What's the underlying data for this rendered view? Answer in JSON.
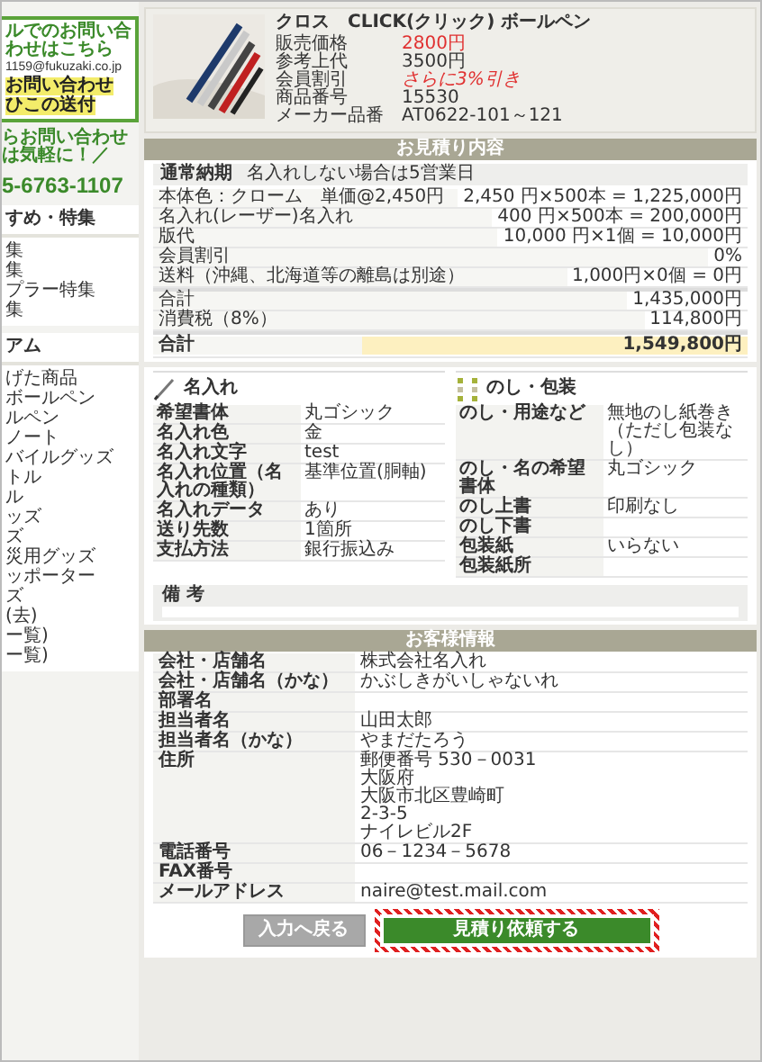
{
  "sidebar": {
    "contact": {
      "mail_label": "ルでのお問い合わせはこちら",
      "email": "1159@fukuzaki.co.jp",
      "links": [
        "お問い合わせ",
        "ひこの送付"
      ]
    },
    "phone_label": "らお問い合わせは気軽に！／",
    "phone": "5-6763-1107",
    "menus": [
      {
        "heading": "すめ・特集",
        "items": [
          "集",
          "集",
          "プラー特集",
          "集"
        ]
      },
      {
        "heading": "アム",
        "items": [
          "げた商品",
          "ボールペン",
          "ルペン",
          "ノート",
          "バイルグッズ",
          "トル",
          "ル",
          "ッズ",
          "ズ",
          "災用グッズ",
          "ッポーター",
          "ズ",
          "(去)",
          "ー覧)",
          "ー覧)"
        ]
      }
    ]
  },
  "product": {
    "title": "クロス　CLICK(クリック) ボールペン",
    "specs": [
      {
        "label": "販売価格",
        "value": "2800円",
        "kind": "price"
      },
      {
        "label": "参考上代",
        "value": "3500円",
        "kind": "plain"
      },
      {
        "label": "会員割引",
        "value": "さらに3%引き",
        "kind": "discount"
      },
      {
        "label": "商品番号",
        "value": "15530",
        "kind": "plain"
      },
      {
        "label": "メーカー品番",
        "value": "AT0622-101～121",
        "kind": "plain"
      }
    ]
  },
  "quote": {
    "title": "お見積り内容",
    "delivery_label": "通常納期",
    "delivery_value": "名入れしない場合は5営業日",
    "rows": [
      {
        "label": "本体色：クローム　単価@2,450円",
        "value": "2,450 円×500本 = 1,225,000円",
        "kind": "line"
      },
      {
        "label": "名入れ(レーザー)名入れ",
        "value": "400 円×500本 = 200,000円",
        "kind": "line"
      },
      {
        "label": "版代",
        "value": "10,000 円×1個 = 10,000円",
        "kind": "line"
      },
      {
        "label": "会員割引",
        "value": "0%",
        "kind": "line"
      },
      {
        "label": "送料（沖縄、北海道等の離島は別途）",
        "value": "1,000円×0個 = 0円",
        "kind": "line"
      },
      {
        "label": "合計",
        "value": "1,435,000円",
        "kind": "subtotal"
      },
      {
        "label": "消費税（8%）",
        "value": "114,800円",
        "kind": "line"
      },
      {
        "label": "合計",
        "value": "1,549,800円",
        "kind": "total"
      }
    ]
  },
  "details": [
    {
      "title": "名入れ",
      "kind": "pen",
      "rows": [
        {
          "label": "希望書体",
          "value": "丸ゴシック"
        },
        {
          "label": "名入れ色",
          "value": "金"
        },
        {
          "label": "名入れ文字",
          "value": "test"
        },
        {
          "label": "名入れ位置（名入れの種類）",
          "value": "基準位置(胴軸)"
        },
        {
          "label": "名入れデータ",
          "value": "あり"
        },
        {
          "label": "送り先数",
          "value": "1箇所"
        },
        {
          "label": "支払方法",
          "value": "銀行振込み"
        }
      ]
    },
    {
      "title": "のし・包装",
      "kind": "gift",
      "rows": [
        {
          "label": "のし・用途など",
          "value": "無地のし紙巻き（ただし包装なし）"
        },
        {
          "label": "のし・名の希望書体",
          "value": "丸ゴシック"
        },
        {
          "label": "のし上書",
          "value": "印刷なし"
        },
        {
          "label": "のし下書"
        },
        {
          "label": "包装紙",
          "value": "いらない"
        },
        {
          "label": "包装紙所"
        }
      ]
    }
  ],
  "remarks": {
    "label": "備 考"
  },
  "customer": {
    "title": "お客様情報",
    "rows": [
      {
        "label": "会社・店舗名",
        "value": "株式会社名入れ"
      },
      {
        "label": "会社・店舗名（かな）",
        "value": "かぶしきがいしゃないれ"
      },
      {
        "label": "部署名"
      },
      {
        "label": "担当者名",
        "value": "山田太郎"
      },
      {
        "label": "担当者名（かな）",
        "value": "やまだたろう"
      },
      {
        "label": "住所",
        "lines": [
          "郵便番号 530－0031",
          "大阪府",
          "大阪市北区豊崎町",
          "2-3-5",
          "ナイレビル2F"
        ]
      },
      {
        "label": "電話番号",
        "value": "06－1234－5678"
      },
      {
        "label": "FAX番号"
      },
      {
        "label": "メールアドレス",
        "value": "naire@test.mail.com"
      }
    ]
  },
  "actions": [
    {
      "label": "入力へ戻る",
      "kind": "back",
      "highlighted": false
    },
    {
      "label": "見積り依頼する",
      "kind": "submit",
      "highlighted": true
    }
  ]
}
